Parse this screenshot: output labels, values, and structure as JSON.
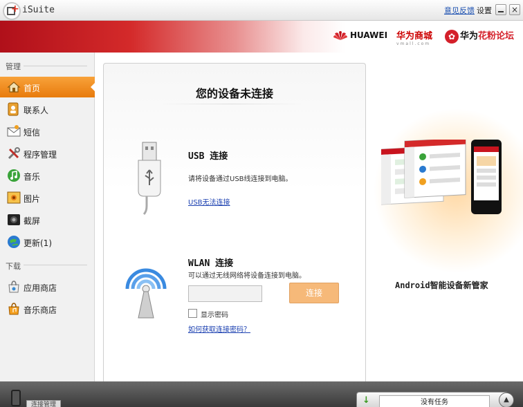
{
  "window": {
    "title": "iSuite",
    "feedback_link": "意见反馈",
    "settings": "设置",
    "close_glyph": "×"
  },
  "banner": {
    "huawei": "HUAWEI",
    "vmall": "华为商城",
    "vmall_sub": "vmall.com",
    "forum_prefix": "华为",
    "forum_suffix": "花粉论坛"
  },
  "sidebar": {
    "manage_label": "管理",
    "download_label": "下载",
    "manage_items": [
      {
        "label": "首页",
        "icon": "home-icon",
        "active": true
      },
      {
        "label": "联系人",
        "icon": "contacts-icon"
      },
      {
        "label": "短信",
        "icon": "sms-icon"
      },
      {
        "label": "程序管理",
        "icon": "apps-icon"
      },
      {
        "label": "音乐",
        "icon": "music-icon"
      },
      {
        "label": "图片",
        "icon": "pictures-icon"
      },
      {
        "label": "截屏",
        "icon": "screenshot-icon"
      },
      {
        "label": "更新(1)",
        "icon": "update-icon"
      }
    ],
    "download_items": [
      {
        "label": "应用商店",
        "icon": "app-store-icon"
      },
      {
        "label": "音乐商店",
        "icon": "music-store-icon"
      }
    ]
  },
  "panel": {
    "title": "您的设备未连接",
    "usb": {
      "heading": "USB 连接",
      "description": "请将设备通过USB线连接到电脑。",
      "link": "USB无法连接"
    },
    "wlan": {
      "heading": "WLAN 连接",
      "description": "可以通过无线网络将设备连接到电脑。",
      "password_placeholder": "",
      "connect_button": "连接",
      "show_password": "显示密码",
      "help_link": "如何获取连接密码？"
    }
  },
  "promo": {
    "caption": "Android智能设备新管家"
  },
  "footer": {
    "connection_manager": "连接管理",
    "task_status": "没有任务"
  },
  "colors": {
    "accent": "#e87b0d",
    "brand_red": "#c8141e",
    "link": "#1a3fb0"
  }
}
